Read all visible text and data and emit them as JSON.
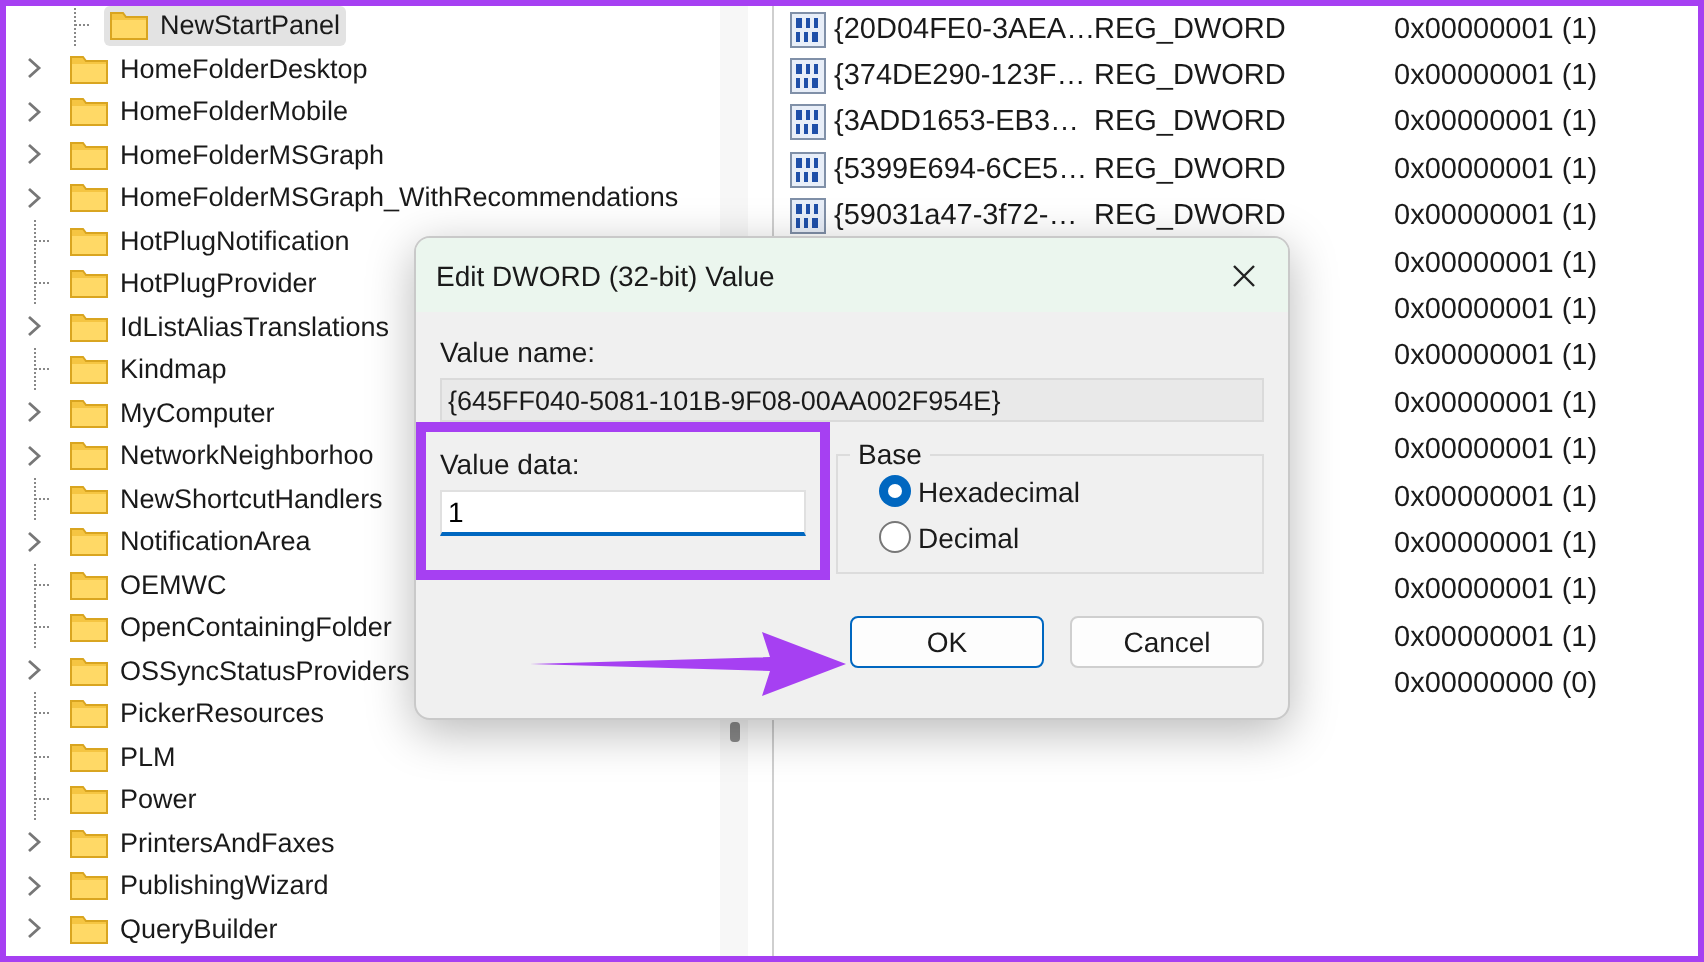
{
  "tree": {
    "hidden_parent_children": [
      {
        "label": "NewStartPanel",
        "has_children": false,
        "selected": true
      }
    ],
    "items": [
      {
        "label": "HomeFolderDesktop",
        "has_children": true,
        "selected": false
      },
      {
        "label": "HomeFolderMobile",
        "has_children": true,
        "selected": false
      },
      {
        "label": "HomeFolderMSGraph",
        "has_children": true,
        "selected": false
      },
      {
        "label": "HomeFolderMSGraph_WithRecommendations",
        "has_children": true,
        "selected": false
      },
      {
        "label": "HotPlugNotification",
        "has_children": false,
        "selected": false
      },
      {
        "label": "HotPlugProvider",
        "has_children": false,
        "selected": false
      },
      {
        "label": "IdListAliasTranslations",
        "has_children": true,
        "selected": false
      },
      {
        "label": "Kindmap",
        "has_children": false,
        "selected": false
      },
      {
        "label": "MyComputer",
        "has_children": true,
        "selected": false
      },
      {
        "label": "NetworkNeighborhoo",
        "has_children": true,
        "selected": false
      },
      {
        "label": "NewShortcutHandlers",
        "has_children": false,
        "selected": false
      },
      {
        "label": "NotificationArea",
        "has_children": true,
        "selected": false
      },
      {
        "label": "OEMWC",
        "has_children": false,
        "selected": false
      },
      {
        "label": "OpenContainingFolder",
        "has_children": false,
        "selected": false
      },
      {
        "label": "OSSyncStatusProviders",
        "has_children": true,
        "selected": false
      },
      {
        "label": "PickerResources",
        "has_children": false,
        "selected": false
      },
      {
        "label": "PLM",
        "has_children": false,
        "selected": false
      },
      {
        "label": "Power",
        "has_children": false,
        "selected": false
      },
      {
        "label": "PrintersAndFaxes",
        "has_children": true,
        "selected": false
      },
      {
        "label": "PublishingWizard",
        "has_children": true,
        "selected": false
      },
      {
        "label": "QueryBuilder",
        "has_children": true,
        "selected": false
      }
    ]
  },
  "values": {
    "rows": [
      {
        "name": "{20D04FE0-3AEA…",
        "type": "REG_DWORD",
        "data": "0x00000001 (1)"
      },
      {
        "name": "{374DE290-123F…",
        "type": "REG_DWORD",
        "data": "0x00000001 (1)"
      },
      {
        "name": "{3ADD1653-EB3…",
        "type": "REG_DWORD",
        "data": "0x00000001 (1)"
      },
      {
        "name": "{5399E694-6CE5…",
        "type": "REG_DWORD",
        "data": "0x00000001 (1)"
      },
      {
        "name": "{59031a47-3f72-…",
        "type": "REG_DWORD",
        "data": "0x00000001 (1)"
      },
      {
        "data": "0x00000001 (1)"
      },
      {
        "data": "0x00000001 (1)"
      },
      {
        "data": "0x00000001 (1)"
      },
      {
        "data": "0x00000001 (1)"
      },
      {
        "data": "0x00000001 (1)"
      },
      {
        "data": "0x00000001 (1)"
      },
      {
        "data": "0x00000001 (1)"
      },
      {
        "data": "0x00000001 (1)"
      },
      {
        "data": "0x00000001 (1)"
      },
      {
        "data": "0x00000000 (0)"
      }
    ]
  },
  "dialog": {
    "title": "Edit DWORD (32-bit) Value",
    "value_name_label": "Value name:",
    "value_name": "{645FF040-5081-101B-9F08-00AA002F954E}",
    "value_data_label": "Value data:",
    "value_data": "1",
    "base_label": "Base",
    "base_options": [
      {
        "label": "Hexadecimal",
        "selected": true
      },
      {
        "label": "Decimal",
        "selected": false
      }
    ],
    "buttons": [
      {
        "label": "OK",
        "default": true
      },
      {
        "label": "Cancel",
        "default": false
      }
    ]
  }
}
